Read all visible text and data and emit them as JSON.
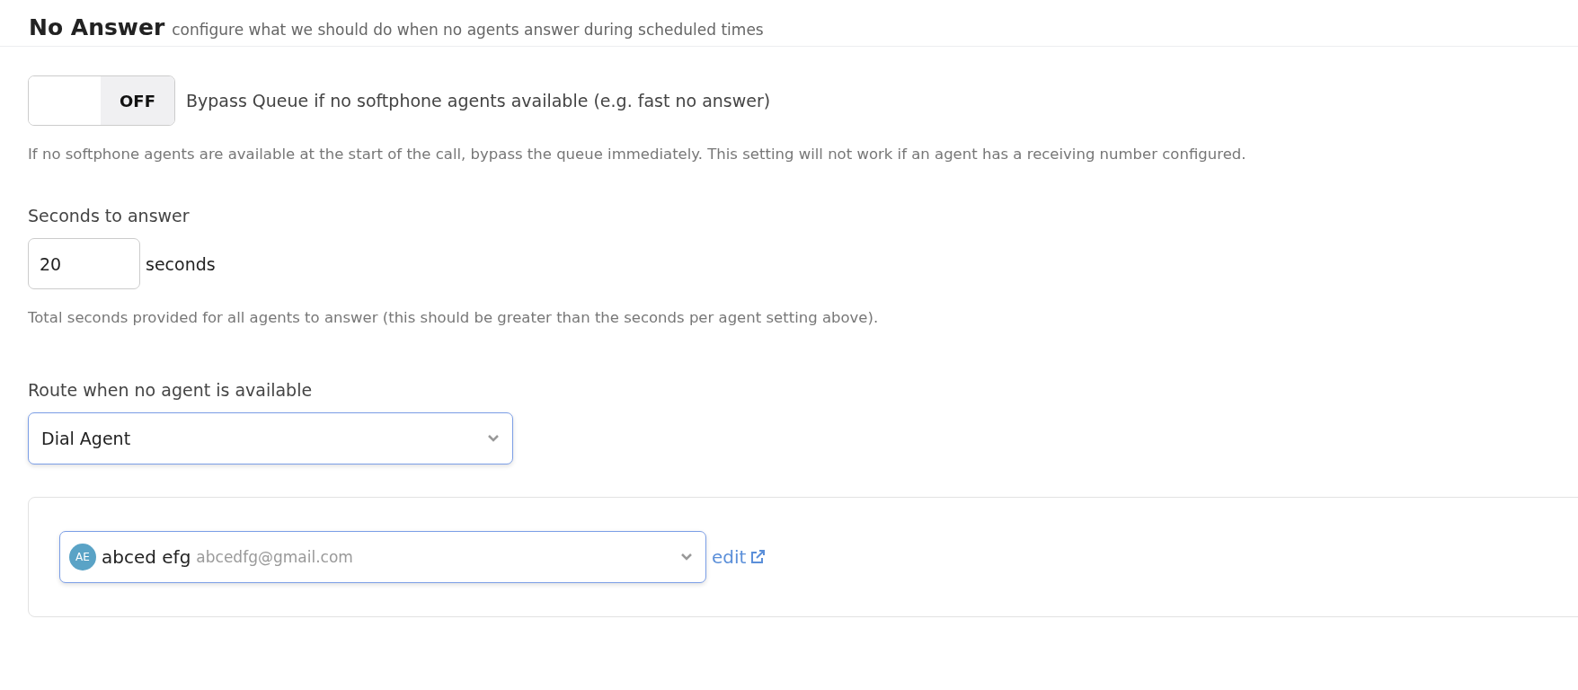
{
  "header": {
    "title": "No Answer",
    "subtitle": "configure what we should do when no agents answer during scheduled times"
  },
  "bypass": {
    "toggle": {
      "on": false,
      "label": "OFF"
    },
    "label": "Bypass Queue if no softphone agents available (e.g. fast no answer)",
    "help": "If no softphone agents are available at the start of the call, bypass the queue immediately. This setting will not work if an agent has a receiving number configured."
  },
  "seconds": {
    "label": "Seconds to answer",
    "value": "20",
    "unit": "seconds",
    "help": "Total seconds provided for all agents to answer (this should be greater than the seconds per agent setting above)."
  },
  "route": {
    "label": "Route when no agent is available",
    "value": "Dial Agent"
  },
  "agent": {
    "initials": "AE",
    "name": "abced efg",
    "email": "abcedfg@gmail.com",
    "link": "edit"
  }
}
